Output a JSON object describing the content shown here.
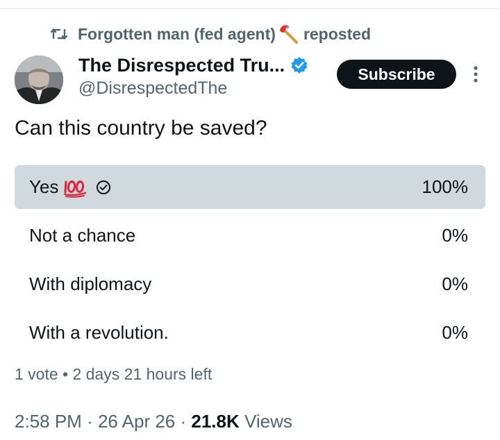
{
  "repost": {
    "user": "Forgotten man (fed agent)",
    "axe_icon": "axe-icon",
    "action": "reposted"
  },
  "author": {
    "display_name": "The Disrespected Tru...",
    "handle": "@DisrespectedThe",
    "verified": true,
    "verified_color": "#1d9bf0"
  },
  "subscribe_label": "Subscribe",
  "tweet_text": "Can this country be saved?",
  "poll": {
    "options": [
      {
        "label": "Yes",
        "emoji": "💯",
        "selected": true,
        "percent_text": "100%",
        "percent": 100
      },
      {
        "label": "Not a chance",
        "selected": false,
        "percent_text": "0%",
        "percent": 0
      },
      {
        "label": "With diplomacy",
        "selected": false,
        "percent_text": "0%",
        "percent": 0
      },
      {
        "label": "With a revolution.",
        "selected": false,
        "percent_text": "0%",
        "percent": 0
      }
    ],
    "votes": "1 vote",
    "time_left": "2 days 21 hours left",
    "fill_color": "#cfd9de"
  },
  "meta": {
    "time": "2:58 PM",
    "date": "26 Apr 26",
    "views_count": "21.8K",
    "views_label": "Views"
  }
}
